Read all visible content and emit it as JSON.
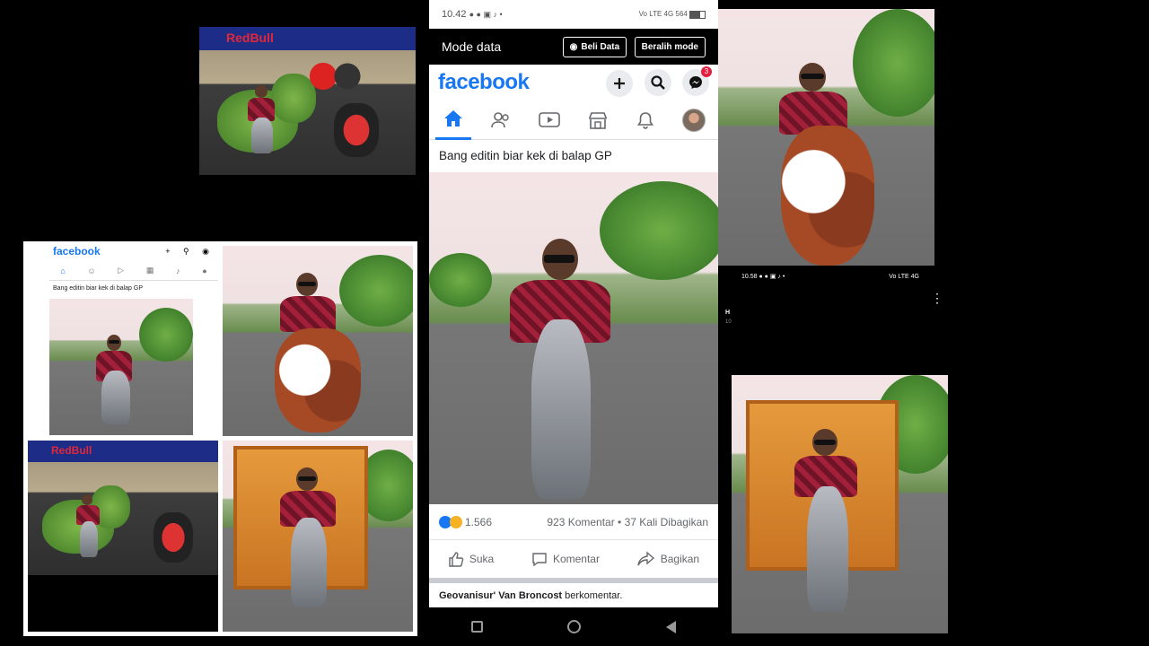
{
  "phone": {
    "status_time": "10.42",
    "status_icons_left": "● ● ▣ ♪ •",
    "status_right": "Vo LTE 4G 564",
    "mode_title": "Mode data",
    "buy_button": "Beli Data",
    "switch_button": "Beralih mode",
    "app_logo": "facebook",
    "messenger_badge": "3",
    "post_caption": "Bang editin biar kek di balap GP",
    "reaction_count": "1.566",
    "comments_shares": "923 Komentar • 37 Kali Dibagikan",
    "like_label": "Suka",
    "comment_label": "Komentar",
    "share_label": "Bagikan",
    "comment_author": "Geovanisur' Van Broncost",
    "comment_suffix": "berkomentar."
  },
  "collage": {
    "app_logo": "facebook",
    "post_caption": "Bang editin biar kek di balap GP"
  },
  "top_left_banner": "RedBull",
  "collage_banner": "RedBull",
  "right_status_time": "10.58",
  "right_status_icons": "● ● ▣ ♪ •",
  "right_status_end": "Vo LTE 4G",
  "right_hint_letter": "H",
  "right_hint_digits": "10",
  "colors": {
    "facebook_blue": "#1877f2",
    "badge_red": "#e41e3f"
  },
  "icons": [
    "home-icon",
    "friends-icon",
    "watch-icon",
    "marketplace-icon",
    "bell-icon",
    "profile-icon",
    "plus-icon",
    "search-icon",
    "messenger-icon",
    "like-icon",
    "comment-icon",
    "share-icon"
  ]
}
